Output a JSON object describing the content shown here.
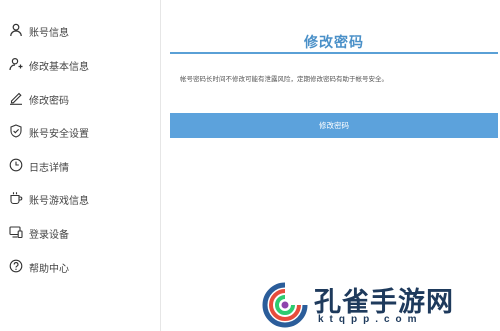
{
  "sidebar": {
    "items": [
      {
        "label": "账号信息",
        "icon": "user-icon"
      },
      {
        "label": "修改基本信息",
        "icon": "user-edit-icon"
      },
      {
        "label": "修改密码",
        "icon": "pencil-icon"
      },
      {
        "label": "账号安全设置",
        "icon": "shield-check-icon"
      },
      {
        "label": "日志详情",
        "icon": "clock-icon"
      },
      {
        "label": "账号游戏信息",
        "icon": "cup-icon"
      },
      {
        "label": "登录设备",
        "icon": "devices-icon"
      },
      {
        "label": "帮助中心",
        "icon": "help-icon"
      }
    ]
  },
  "main": {
    "title": "修改密码",
    "notice": "帐号密码长时间不修改可能有泄露风险，定期修改密码有助于帐号安全。",
    "button_label": "修改密码"
  },
  "watermark": {
    "text": "孔雀手游网",
    "url": "ktqpp.com"
  },
  "colors": {
    "accent": "#4a90c8",
    "button": "#5ca2dc",
    "watermark_text": "#1e3a5c"
  }
}
